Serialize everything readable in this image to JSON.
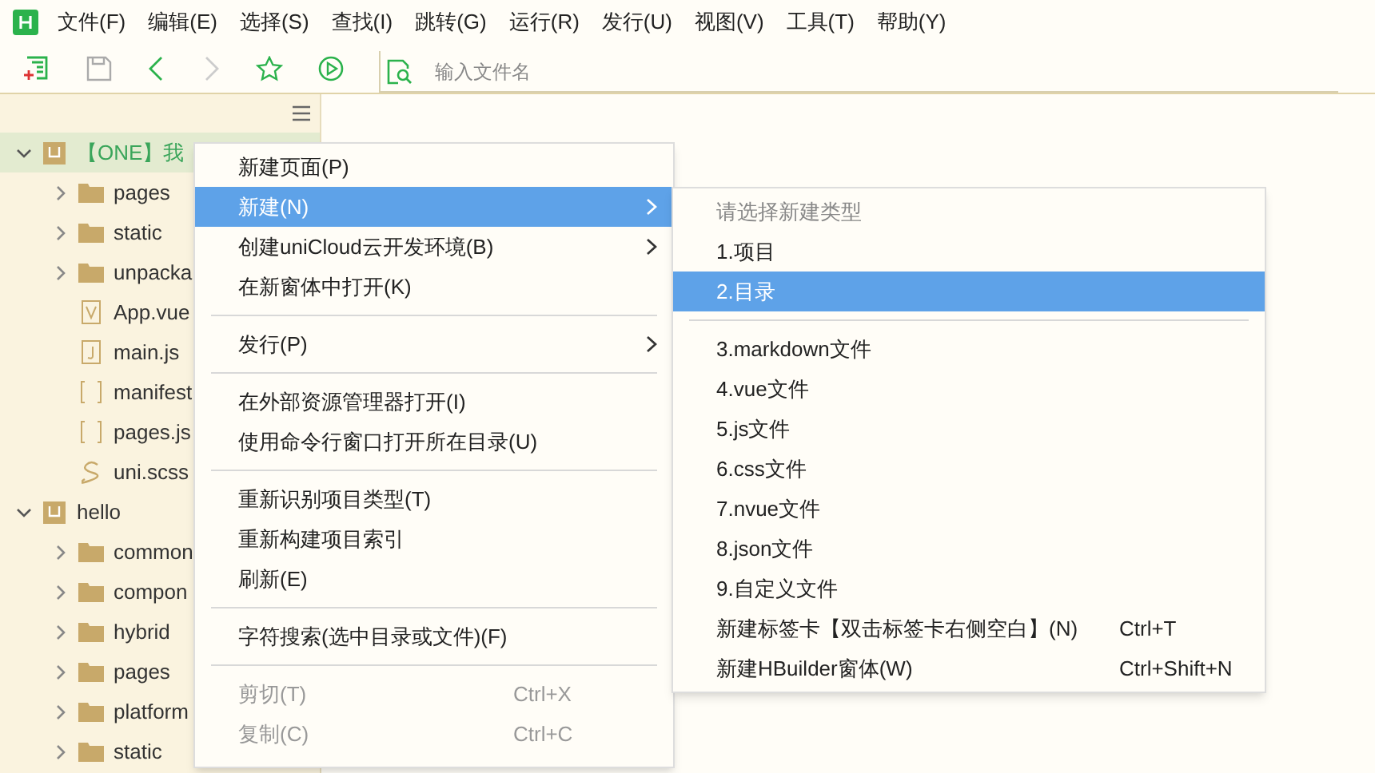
{
  "menu_bar": [
    {
      "label": "文件(F)"
    },
    {
      "label": "编辑(E)"
    },
    {
      "label": "选择(S)"
    },
    {
      "label": "查找(I)"
    },
    {
      "label": "跳转(G)"
    },
    {
      "label": "运行(R)"
    },
    {
      "label": "发行(U)"
    },
    {
      "label": "视图(V)"
    },
    {
      "label": "工具(T)"
    },
    {
      "label": "帮助(Y)"
    }
  ],
  "toolbar": {
    "search": {
      "placeholder": "输入文件名"
    }
  },
  "tree": [
    {
      "label": "【ONE】我",
      "kind": "project",
      "expanded": true,
      "selected": true,
      "children": [
        {
          "label": "pages",
          "kind": "folder",
          "expanded": false,
          "selected": false
        },
        {
          "label": "static",
          "kind": "folder",
          "expanded": false,
          "selected": false
        },
        {
          "label": "unpacka",
          "kind": "folder",
          "expanded": false,
          "selected": false
        },
        {
          "label": "App.vue",
          "kind": "vue",
          "selected": false
        },
        {
          "label": "main.js",
          "kind": "js",
          "selected": false
        },
        {
          "label": "manifest",
          "kind": "json",
          "selected": false
        },
        {
          "label": "pages.js",
          "kind": "json",
          "selected": false
        },
        {
          "label": "uni.scss",
          "kind": "scss",
          "selected": false
        }
      ]
    },
    {
      "label": "hello",
      "kind": "project",
      "expanded": true,
      "selected": false,
      "children": [
        {
          "label": "common",
          "kind": "folder",
          "expanded": false,
          "selected": false
        },
        {
          "label": "compon",
          "kind": "folder",
          "expanded": false,
          "selected": false
        },
        {
          "label": "hybrid",
          "kind": "folder",
          "expanded": false,
          "selected": false
        },
        {
          "label": "pages",
          "kind": "folder",
          "expanded": false,
          "selected": false
        },
        {
          "label": "platform",
          "kind": "folder",
          "expanded": false,
          "selected": false
        },
        {
          "label": "static",
          "kind": "folder",
          "expanded": false,
          "selected": false
        }
      ]
    }
  ],
  "context_menu": [
    {
      "kind": "item",
      "label": "新建页面(P)",
      "submenu": false,
      "selected": false,
      "disabled": false
    },
    {
      "kind": "item",
      "label": "新建(N)",
      "submenu": true,
      "selected": true,
      "disabled": false
    },
    {
      "kind": "item",
      "label": "创建uniCloud云开发环境(B)",
      "submenu": true,
      "selected": false,
      "disabled": false
    },
    {
      "kind": "item",
      "label": "在新窗体中打开(K)",
      "submenu": false,
      "selected": false,
      "disabled": false
    },
    {
      "kind": "separator"
    },
    {
      "kind": "item",
      "label": "发行(P)",
      "submenu": true,
      "selected": false,
      "disabled": false
    },
    {
      "kind": "separator"
    },
    {
      "kind": "item",
      "label": "在外部资源管理器打开(I)",
      "submenu": false,
      "selected": false,
      "disabled": false
    },
    {
      "kind": "item",
      "label": "使用命令行窗口打开所在目录(U)",
      "submenu": false,
      "selected": false,
      "disabled": false
    },
    {
      "kind": "separator"
    },
    {
      "kind": "item",
      "label": "重新识别项目类型(T)",
      "submenu": false,
      "selected": false,
      "disabled": false
    },
    {
      "kind": "item",
      "label": "重新构建项目索引",
      "submenu": false,
      "selected": false,
      "disabled": false
    },
    {
      "kind": "item",
      "label": "刷新(E)",
      "submenu": false,
      "selected": false,
      "disabled": false
    },
    {
      "kind": "separator"
    },
    {
      "kind": "item",
      "label": "字符搜索(选中目录或文件)(F)",
      "submenu": false,
      "selected": false,
      "disabled": false
    },
    {
      "kind": "separator"
    },
    {
      "kind": "item",
      "label": "剪切(T)",
      "shortcut": "Ctrl+X",
      "submenu": false,
      "selected": false,
      "disabled": true
    },
    {
      "kind": "item",
      "label": "复制(C)",
      "shortcut": "Ctrl+C",
      "submenu": false,
      "selected": false,
      "disabled": true
    }
  ],
  "submenu": [
    {
      "kind": "header",
      "label": "请选择新建类型"
    },
    {
      "kind": "item",
      "label": "1.项目",
      "selected": false
    },
    {
      "kind": "item",
      "label": "2.目录",
      "selected": true
    },
    {
      "kind": "separator"
    },
    {
      "kind": "item",
      "label": "3.markdown文件",
      "selected": false
    },
    {
      "kind": "item",
      "label": "4.vue文件",
      "selected": false
    },
    {
      "kind": "item",
      "label": "5.js文件",
      "selected": false
    },
    {
      "kind": "item",
      "label": "6.css文件",
      "selected": false
    },
    {
      "kind": "item",
      "label": "7.nvue文件",
      "selected": false
    },
    {
      "kind": "item",
      "label": "8.json文件",
      "selected": false
    },
    {
      "kind": "item",
      "label": "9.自定义文件",
      "selected": false
    },
    {
      "kind": "item",
      "label": "新建标签卡【双击标签卡右侧空白】(N)",
      "shortcut": "Ctrl+T",
      "selected": false
    },
    {
      "kind": "item",
      "label": "新建HBuilder窗体(W)",
      "shortcut": "Ctrl+Shift+N",
      "selected": false
    }
  ]
}
